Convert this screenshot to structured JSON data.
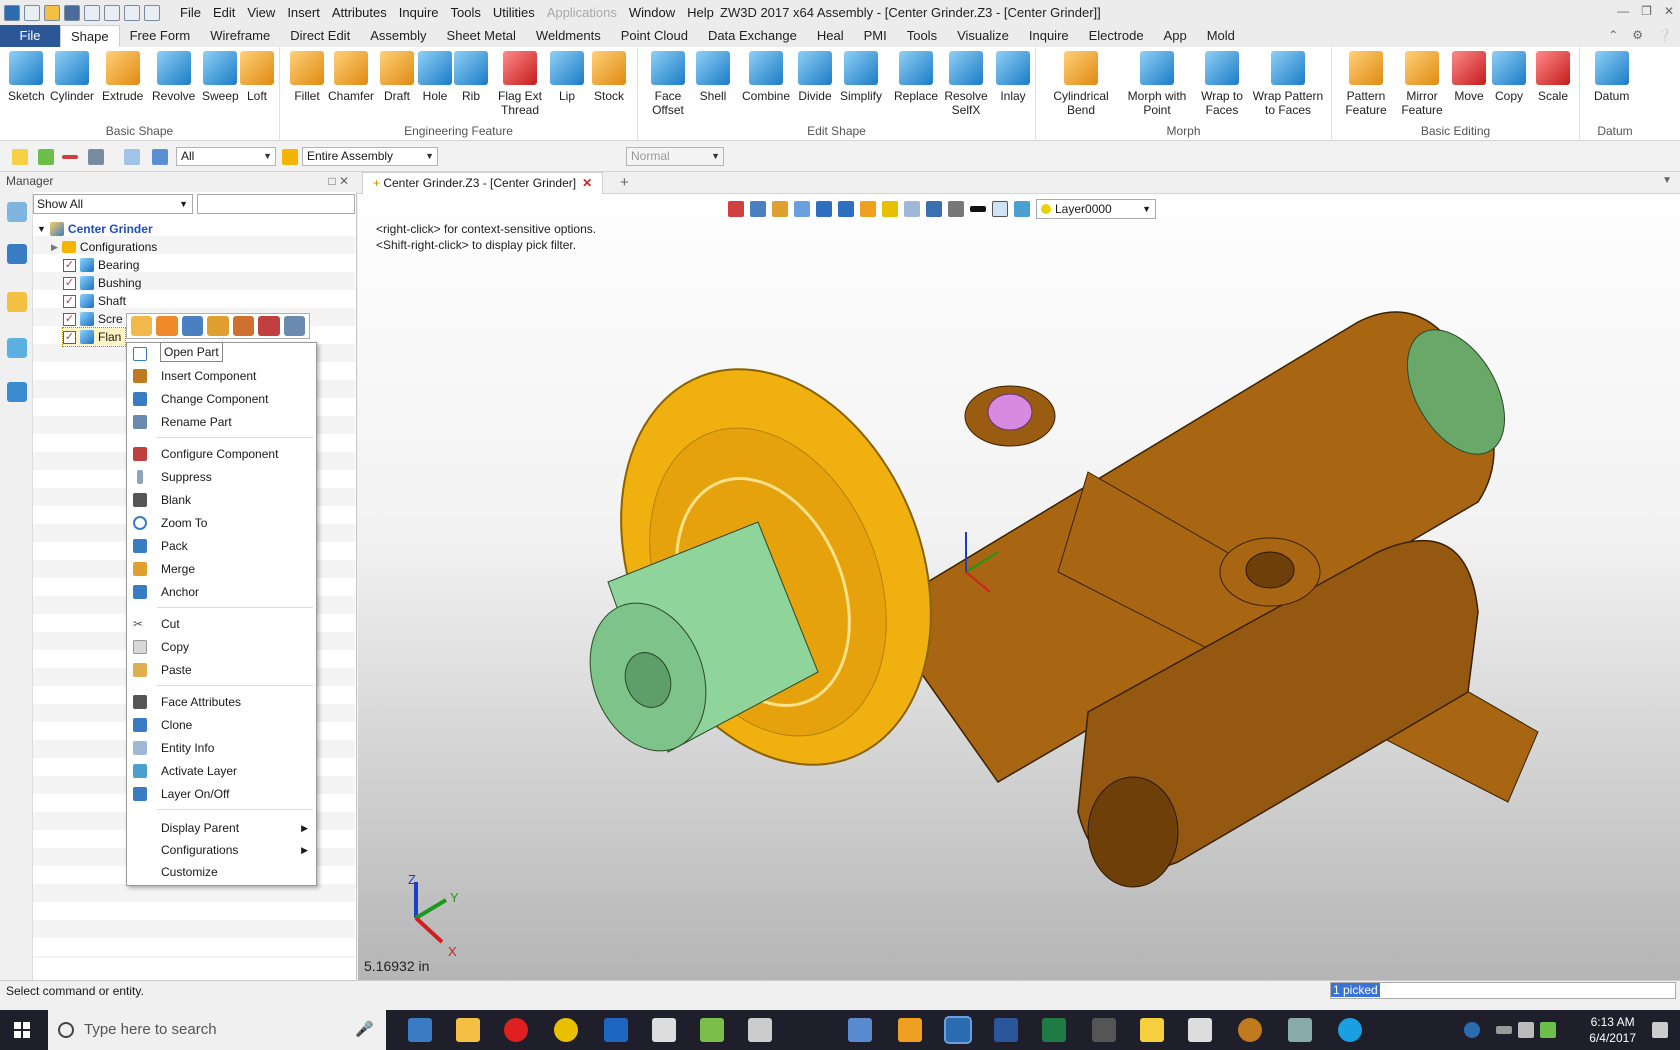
{
  "title_bar": {
    "menu": [
      "File",
      "Edit",
      "View",
      "Insert",
      "Attributes",
      "Inquire",
      "Tools",
      "Utilities",
      "Applications",
      "Window",
      "Help"
    ],
    "app_title": "ZW3D 2017 x64     Assembly - [Center Grinder.Z3 - [Center Grinder]]"
  },
  "ribbon_tabs": [
    "File",
    "Shape",
    "Free Form",
    "Wireframe",
    "Direct Edit",
    "Assembly",
    "Sheet Metal",
    "Weldments",
    "Point Cloud",
    "Data Exchange",
    "Heal",
    "PMI",
    "Tools",
    "Visualize",
    "Inquire",
    "Electrode",
    "App",
    "Mold"
  ],
  "active_ribbon_tab": "Shape",
  "ribbon": {
    "basic_shape": {
      "label": "Basic Shape",
      "buttons": [
        "Sketch",
        "Cylinder",
        "Extrude",
        "Revolve",
        "Sweep",
        "Loft"
      ]
    },
    "engineering_feature": {
      "label": "Engineering Feature",
      "buttons": [
        "Fillet",
        "Chamfer",
        "Draft",
        "Hole",
        "Rib",
        "Flag Ext Thread",
        "Lip",
        "Stock"
      ]
    },
    "edit_shape": {
      "label": "Edit Shape",
      "buttons": [
        "Face Offset",
        "Shell",
        "Combine",
        "Divide",
        "Simplify",
        "Replace",
        "Resolve SelfX",
        "Inlay"
      ]
    },
    "morph": {
      "label": "Morph",
      "buttons": [
        "Cylindrical Bend",
        "Morph with Point",
        "Wrap to Faces",
        "Wrap Pattern to Faces"
      ]
    },
    "basic_editing": {
      "label": "Basic Editing",
      "buttons": [
        "Pattern Feature",
        "Mirror Feature",
        "Move",
        "Copy",
        "Scale"
      ]
    },
    "datum": {
      "label": "Datum",
      "buttons": [
        "Datum"
      ]
    }
  },
  "toolbar2": {
    "filter": "All",
    "scope": "Entire Assembly",
    "mode": "Normal"
  },
  "manager": {
    "title": "Manager",
    "show_filter": "Show All",
    "tree": {
      "root": "Center Grinder",
      "configurations": "Configurations",
      "parts": [
        "Bearing",
        "Bushing",
        "Shaft",
        "Scre",
        "Flan"
      ]
    }
  },
  "doc_tab": "Center Grinder.Z3 - [Center Grinder]",
  "viewport": {
    "hint1": "<right-click> for context-sensitive options.",
    "hint2": "<Shift-right-click> to display pick filter.",
    "layer": "Layer0000",
    "measure": "5.16932 in",
    "axes": {
      "x": "X",
      "y": "Y",
      "z": "Z"
    }
  },
  "tooltip": "Open Part",
  "context_menu": {
    "group1": [
      "Insert Component",
      "Change Component",
      "Rename Part"
    ],
    "group2": [
      "Configure Component",
      "Suppress",
      "Blank",
      "Zoom To",
      "Pack",
      "Merge",
      "Anchor"
    ],
    "group3": [
      "Cut",
      "Copy",
      "Paste"
    ],
    "group4": [
      "Face Attributes",
      "Clone",
      "Entity Info",
      "Activate Layer",
      "Layer On/Off"
    ],
    "group5": [
      "Display Parent",
      "Configurations",
      "Customize"
    ]
  },
  "status": {
    "message": "Select command or entity.",
    "picked": "1 picked"
  },
  "taskbar": {
    "search": "Type here to search",
    "time": "6:13 AM",
    "date": "6/4/2017"
  }
}
